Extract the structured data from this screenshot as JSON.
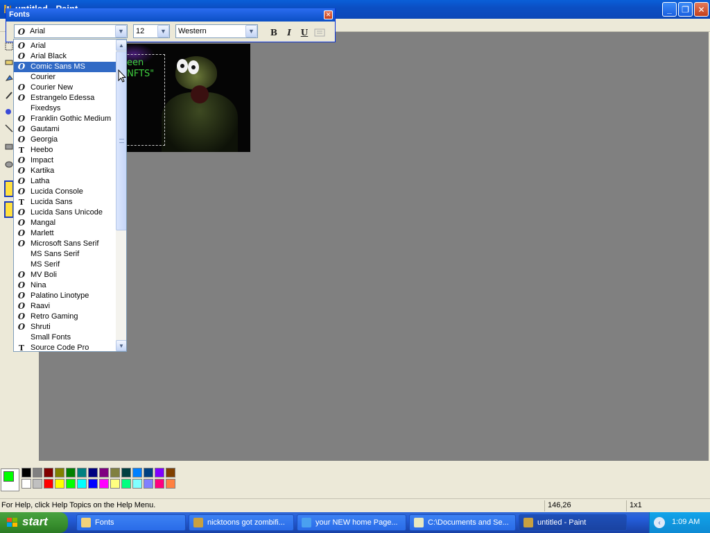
{
  "window": {
    "title": "untitled - Paint",
    "minimize_label": "_",
    "restore_label": "❐",
    "close_label": "✕"
  },
  "fonts_toolbar": {
    "title": "Fonts",
    "close_label": "✕",
    "font_name": "Arial",
    "font_size": "12",
    "script": "Western",
    "bold_label": "B",
    "italic_label": "I",
    "underline_label": "U"
  },
  "font_list": {
    "items": [
      {
        "label": "Arial",
        "type": "opentype"
      },
      {
        "label": "Arial Black",
        "type": "opentype"
      },
      {
        "label": "Comic Sans MS",
        "type": "opentype",
        "selected": true
      },
      {
        "label": "Courier",
        "type": "none"
      },
      {
        "label": "Courier New",
        "type": "opentype"
      },
      {
        "label": "Estrangelo Edessa",
        "type": "opentype"
      },
      {
        "label": "Fixedsys",
        "type": "none"
      },
      {
        "label": "Franklin Gothic Medium",
        "type": "opentype"
      },
      {
        "label": "Gautami",
        "type": "opentype"
      },
      {
        "label": "Georgia",
        "type": "opentype"
      },
      {
        "label": "Heebo",
        "type": "truetype"
      },
      {
        "label": "Impact",
        "type": "opentype"
      },
      {
        "label": "Kartika",
        "type": "opentype"
      },
      {
        "label": "Latha",
        "type": "opentype"
      },
      {
        "label": "Lucida Console",
        "type": "opentype"
      },
      {
        "label": "Lucida Sans",
        "type": "truetype"
      },
      {
        "label": "Lucida Sans Unicode",
        "type": "opentype"
      },
      {
        "label": "Mangal",
        "type": "opentype"
      },
      {
        "label": "Marlett",
        "type": "opentype"
      },
      {
        "label": "Microsoft Sans Serif",
        "type": "opentype"
      },
      {
        "label": "MS Sans Serif",
        "type": "none"
      },
      {
        "label": "MS Serif",
        "type": "none"
      },
      {
        "label": "MV Boli",
        "type": "opentype"
      },
      {
        "label": "Nina",
        "type": "opentype"
      },
      {
        "label": "Palatino Linotype",
        "type": "opentype"
      },
      {
        "label": "Raavi",
        "type": "opentype"
      },
      {
        "label": "Retro Gaming",
        "type": "opentype"
      },
      {
        "label": "Shruti",
        "type": "opentype"
      },
      {
        "label": "Small Fonts",
        "type": "none"
      },
      {
        "label": "Source Code Pro",
        "type": "truetype"
      }
    ]
  },
  "canvas_image": {
    "text_line1": "een",
    "text_line2": "\" NFTS\""
  },
  "palette": {
    "foreground": "#00ff00",
    "colors_top": [
      "#000000",
      "#808080",
      "#800000",
      "#808000",
      "#008000",
      "#008080",
      "#000080",
      "#800080",
      "#808040",
      "#004040",
      "#0080ff",
      "#004080",
      "#8000ff",
      "#804000"
    ],
    "colors_bottom": [
      "#ffffff",
      "#c0c0c0",
      "#ff0000",
      "#ffff00",
      "#00ff00",
      "#00ffff",
      "#0000ff",
      "#ff00ff",
      "#ffff80",
      "#00ff80",
      "#80ffff",
      "#8080ff",
      "#ff0080",
      "#ff8040"
    ]
  },
  "statusbar": {
    "help": "For Help, click Help Topics on the Help Menu.",
    "position": "146,26",
    "size": "1x1"
  },
  "taskbar": {
    "start_label": "start",
    "tasks": [
      {
        "label": "Fonts",
        "icon": "folder-icon"
      },
      {
        "label": "nicktoons got zombifi...",
        "icon": "paint-icon"
      },
      {
        "label": "your NEW home Page...",
        "icon": "ie-icon"
      },
      {
        "label": "C:\\Documents and Se...",
        "icon": "notepad-icon"
      },
      {
        "label": "untitled - Paint",
        "icon": "paint-icon",
        "active": true
      }
    ],
    "clock": "1:09 AM"
  }
}
